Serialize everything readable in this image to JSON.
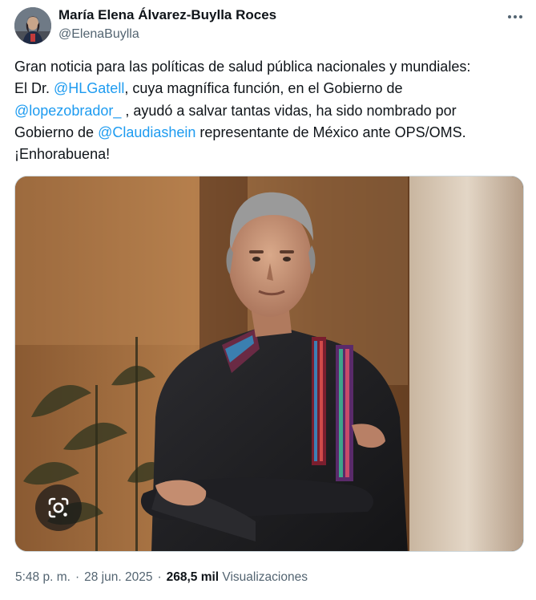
{
  "author": {
    "name": "María Elena Álvarez-Buylla Roces",
    "handle": "@ElenaBuylla"
  },
  "tweet": {
    "line1": "Gran noticia para las políticas de salud pública nacionales y mundiales:",
    "line2_prefix": "El Dr. ",
    "mention_1": "@HLGatell",
    "line2_suffix": ", cuya magnífica función, en el Gobierno de",
    "mention_2": "@lopezobrador_",
    "line3_suffix": " , ayudó a salvar tantas vidas, ha sido nombrado por",
    "line4_prefix": "Gobierno de ",
    "mention_3": "@Claudiashein",
    "line4_suffix": " representante de México ante OPS/OMS.",
    "line5": "¡Enhorabuena!"
  },
  "meta": {
    "time": "5:48 p. m.",
    "separator": "·",
    "date": "28 jun. 2025",
    "views_count": "268,5 mil",
    "views_label": "Visualizaciones"
  },
  "colors": {
    "link": "#1d9bf0",
    "secondary_text": "#536471",
    "primary_text": "#0f1419"
  },
  "icons": {
    "more": "more-dots-icon",
    "lens": "google-lens-icon"
  }
}
